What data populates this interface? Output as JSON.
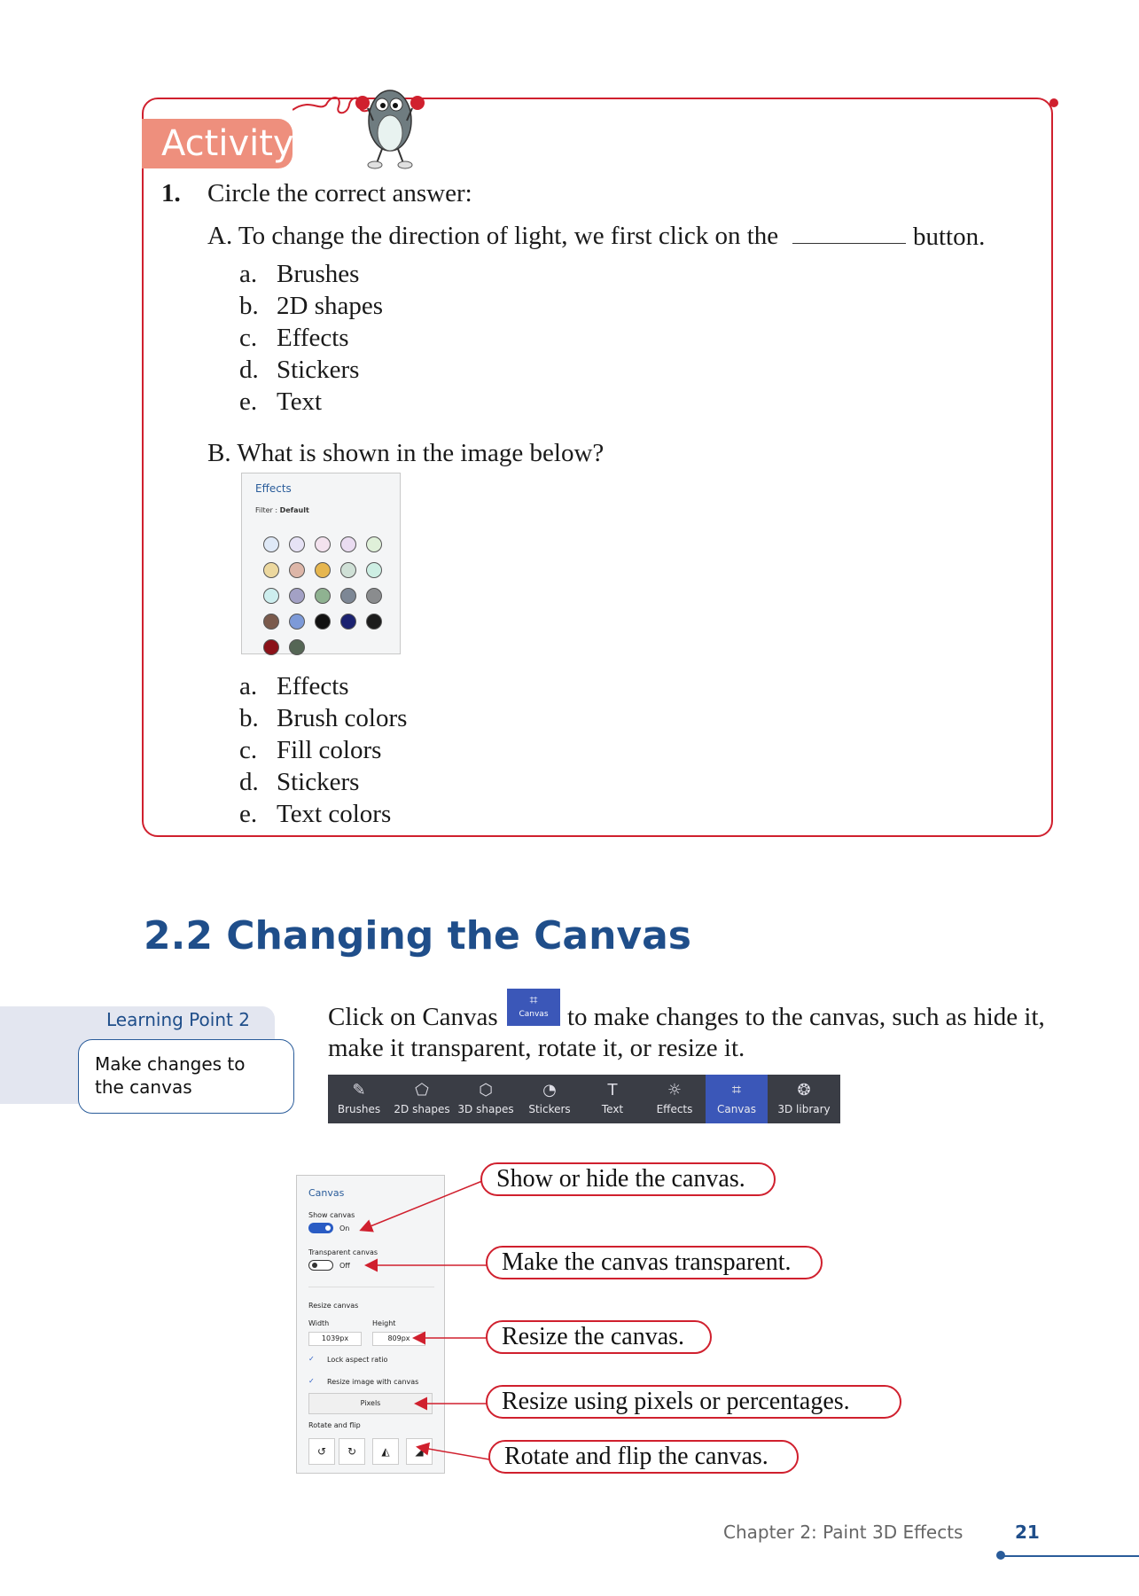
{
  "activity": {
    "tab_label": "Activity",
    "question_number": "1.",
    "question_text": "Circle the correct answer:",
    "part_a": {
      "text": "A. To change the direction of light, we first click on the",
      "suffix": "button.",
      "options": [
        {
          "letter": "a.",
          "text": "Brushes"
        },
        {
          "letter": "b.",
          "text": "2D shapes"
        },
        {
          "letter": "c.",
          "text": "Effects"
        },
        {
          "letter": "d.",
          "text": "Stickers"
        },
        {
          "letter": "e.",
          "text": "Text"
        }
      ]
    },
    "part_b": {
      "text": "B. What is shown in the image below?",
      "panel": {
        "title": "Effects",
        "filter_label": "Filter :",
        "filter_value": "Default",
        "swatches": [
          "#dfe9f7",
          "#e6e2f5",
          "#f3e2ee",
          "#eadcf1",
          "#dff0d9",
          "#ecd89f",
          "#ddb6a8",
          "#e6b64f",
          "#cfe0d6",
          "#cdeee3",
          "#cdeeee",
          "#a3a1c5",
          "#8fb291",
          "#7d8795",
          "#8a8c8e",
          "#7a5a4c",
          "#7d9ad8",
          "#111111",
          "#1b2270",
          "#1c1c1c",
          "#8b1219",
          "#556655"
        ]
      },
      "options": [
        {
          "letter": "a.",
          "text": "Effects"
        },
        {
          "letter": "b.",
          "text": "Brush colors"
        },
        {
          "letter": "c.",
          "text": "Fill colors"
        },
        {
          "letter": "d.",
          "text": "Stickers"
        },
        {
          "letter": "e.",
          "text": "Text colors"
        }
      ]
    }
  },
  "section": {
    "heading": "2.2 Changing the Canvas"
  },
  "learning_point": {
    "title": "Learning Point 2",
    "text": "Make changes to the canvas"
  },
  "intro": {
    "text_before_icon": "Click on Canvas",
    "icon_label": "Canvas",
    "text_after_icon": "to make changes to the canvas, such as hide it,",
    "line2": "make it transparent, rotate it, or resize it."
  },
  "toolbar": {
    "items": [
      {
        "label": "Brushes",
        "icon": "brush-icon",
        "glyph": "✎"
      },
      {
        "label": "2D shapes",
        "icon": "2d-shapes-icon",
        "glyph": "⬠"
      },
      {
        "label": "3D shapes",
        "icon": "3d-shapes-icon",
        "glyph": "⬡"
      },
      {
        "label": "Stickers",
        "icon": "stickers-icon",
        "glyph": "◔"
      },
      {
        "label": "Text",
        "icon": "text-icon",
        "glyph": "T"
      },
      {
        "label": "Effects",
        "icon": "effects-icon",
        "glyph": "☼"
      },
      {
        "label": "Canvas",
        "icon": "canvas-icon",
        "glyph": "⌗"
      },
      {
        "label": "3D library",
        "icon": "3d-library-icon",
        "glyph": "❂"
      }
    ],
    "active": "Canvas",
    "active_color": "#3b57b8"
  },
  "canvas_panel": {
    "title": "Canvas",
    "show_canvas_label": "Show canvas",
    "show_canvas_state": "On",
    "transparent_label": "Transparent canvas",
    "transparent_state": "Off",
    "resize_label": "Resize canvas",
    "width_label": "Width",
    "height_label": "Height",
    "width_value": "1039px",
    "height_value": "809px",
    "lock_label": "Lock aspect ratio",
    "resize_image_label": "Resize image with canvas",
    "unit_value": "Pixels",
    "rotate_label": "Rotate and flip"
  },
  "callouts": [
    "Show or hide the canvas.",
    "Make the canvas transparent.",
    "Resize the canvas.",
    "Resize using pixels or percentages.",
    "Rotate and flip the canvas."
  ],
  "footer": {
    "chapter": "Chapter 2: Paint 3D Effects",
    "page": "21"
  },
  "colors": {
    "accent_red": "#d0202e",
    "heading_blue": "#1f4e8a",
    "activity_tab": "#ee8f7d"
  }
}
